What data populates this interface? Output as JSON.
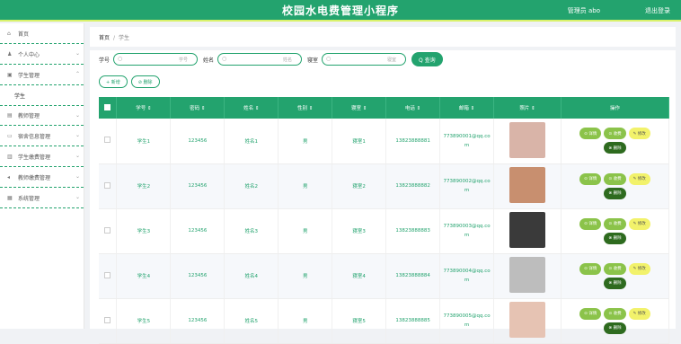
{
  "header": {
    "title": "校园水电费管理小程序",
    "user": "管理员 abo",
    "logout": "退出登录"
  },
  "sidebar": {
    "items": [
      {
        "label": "首页",
        "icon": "home-icon",
        "glyph": "⌂"
      },
      {
        "label": "个人中心",
        "icon": "user-icon",
        "glyph": "♟"
      },
      {
        "label": "学生管理",
        "icon": "student-icon",
        "glyph": "▣"
      },
      {
        "label": "教师管理",
        "icon": "teacher-icon",
        "glyph": "▤"
      },
      {
        "label": "宿舍信息管理",
        "icon": "chat-icon",
        "glyph": "▭"
      },
      {
        "label": "学生缴费管理",
        "icon": "chart-icon",
        "glyph": "▥"
      },
      {
        "label": "教师缴费管理",
        "icon": "send-icon",
        "glyph": "◂"
      },
      {
        "label": "系统管理",
        "icon": "system-icon",
        "glyph": "▦"
      }
    ],
    "sub": "学生"
  },
  "breadcrumb": {
    "home": "首页",
    "sep": "/",
    "current": "学生"
  },
  "search": {
    "label1": "学号",
    "ph1": "学号",
    "label2": "姓名",
    "ph2": "姓名",
    "label3": "寝室",
    "ph3": "寝室",
    "button": "Q 查询"
  },
  "actions": {
    "add": "+ 新增",
    "delete": "⊘ 删除"
  },
  "table": {
    "headers": [
      "学号 ⇕",
      "密码 ⇕",
      "姓名 ⇕",
      "性别 ⇕",
      "寝室 ⇕",
      "电话 ⇕",
      "邮箱 ⇕",
      "照片 ⇕",
      "操作"
    ],
    "rows": [
      {
        "id": "学生1",
        "pwd": "123456",
        "name": "姓名1",
        "gender": "男",
        "room": "寝室1",
        "phone": "13823888881",
        "email1": "773890001@qq.co",
        "email2": "m",
        "photo": "#d9b4a8"
      },
      {
        "id": "学生2",
        "pwd": "123456",
        "name": "姓名2",
        "gender": "男",
        "room": "寝室2",
        "phone": "13823888882",
        "email1": "773890002@qq.co",
        "email2": "m",
        "photo": "#c88f6f"
      },
      {
        "id": "学生3",
        "pwd": "123456",
        "name": "姓名3",
        "gender": "男",
        "room": "寝室3",
        "phone": "13823888883",
        "email1": "773890003@qq.co",
        "email2": "m",
        "photo": "#3a3a3a"
      },
      {
        "id": "学生4",
        "pwd": "123456",
        "name": "姓名4",
        "gender": "男",
        "room": "寝室4",
        "phone": "13823888884",
        "email1": "773890004@qq.co",
        "email2": "m",
        "photo": "#bdbdbd"
      },
      {
        "id": "学生5",
        "pwd": "123456",
        "name": "姓名5",
        "gender": "男",
        "room": "寝室5",
        "phone": "13823888885",
        "email1": "773890005@qq.co",
        "email2": "m",
        "photo": "#e6c3b3"
      }
    ],
    "ops": {
      "detail": "⊙ 详情",
      "charge": "⊙ 收费",
      "edit": "✎ 修改",
      "del": "⊗ 删除"
    }
  },
  "colors": {
    "accent": "#23a36e",
    "highlight": "#d9f26b",
    "dark": "#2e6b1f"
  }
}
